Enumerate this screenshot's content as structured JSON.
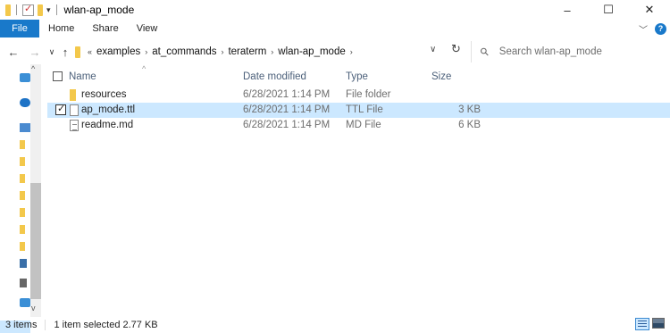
{
  "window": {
    "title": "wlan-ap_mode",
    "minimize": "–",
    "maximize": "☐",
    "close": "✕"
  },
  "ribbon": {
    "tabs": [
      "File",
      "Home",
      "Share",
      "View"
    ]
  },
  "address": {
    "overflow": "«",
    "crumbs": [
      "examples",
      "at_commands",
      "teraterm",
      "wlan-ap_mode"
    ]
  },
  "search": {
    "placeholder": "Search wlan-ap_mode"
  },
  "list": {
    "columns": [
      "Name",
      "Date modified",
      "Type",
      "Size"
    ],
    "rows": [
      {
        "name": "resources",
        "date": "6/28/2021 1:14 PM",
        "type": "File folder",
        "size": "",
        "kind": "folder",
        "selected": false
      },
      {
        "name": "ap_mode.ttl",
        "date": "6/28/2021 1:14 PM",
        "type": "TTL File",
        "size": "3 KB",
        "kind": "file",
        "selected": true
      },
      {
        "name": "readme.md",
        "date": "6/28/2021 1:14 PM",
        "type": "MD File",
        "size": "6 KB",
        "kind": "file-lines",
        "selected": false
      }
    ]
  },
  "status": {
    "count": "3 items",
    "selection": "1 item selected  2.77 KB"
  },
  "colors": {
    "accent": "#1979ca",
    "selection": "#cce8ff",
    "folder": "#f3c84b"
  }
}
